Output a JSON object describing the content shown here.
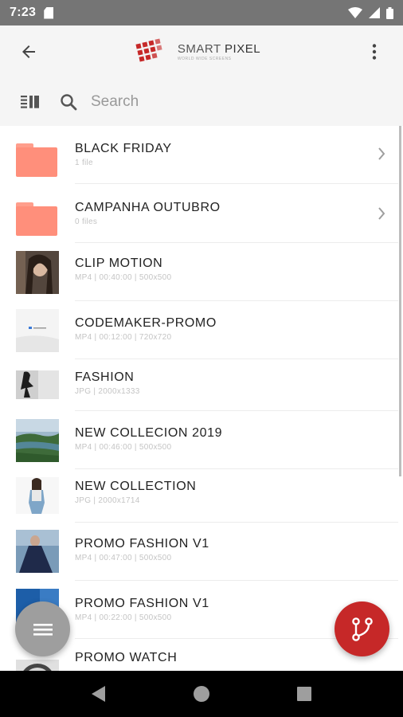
{
  "status_bar": {
    "time": "7:23"
  },
  "app_bar": {
    "logo_title_light": "SMART ",
    "logo_title_bold": "PIXEL",
    "logo_subtitle": "WORLD WIDE SCREENS"
  },
  "search": {
    "placeholder": "Search"
  },
  "items": [
    {
      "type": "folder",
      "name": "BLACK FRIDAY",
      "meta": "1 file"
    },
    {
      "type": "folder",
      "name": "CAMPANHA OUTUBRO",
      "meta": "0 files"
    },
    {
      "type": "media",
      "name": "CLIP MOTION",
      "meta": "MP4 | 00:40:00 | 500x500"
    },
    {
      "type": "media",
      "name": "CODEMAKER-PROMO",
      "meta": "MP4 | 00:12:00 | 720x720"
    },
    {
      "type": "media",
      "name": "FASHION",
      "meta": "JPG | 2000x1333"
    },
    {
      "type": "media",
      "name": "NEW COLLECION 2019",
      "meta": "MP4 | 00:46:00 | 500x500"
    },
    {
      "type": "media",
      "name": "NEW COLLECTION",
      "meta": "JPG | 2000x1714"
    },
    {
      "type": "media",
      "name": "PROMO FASHION V1",
      "meta": "MP4 | 00:47:00 | 500x500"
    },
    {
      "type": "media",
      "name": "PROMO FASHION V1",
      "meta": "MP4 | 00:22:00 | 500x500"
    },
    {
      "type": "media",
      "name": "PROMO WATCH",
      "meta": ""
    }
  ],
  "colors": {
    "status_bar": "#757575",
    "folder": "#ff8f7b",
    "fab_action": "#c62828",
    "fab_menu": "#9e9e9e"
  }
}
